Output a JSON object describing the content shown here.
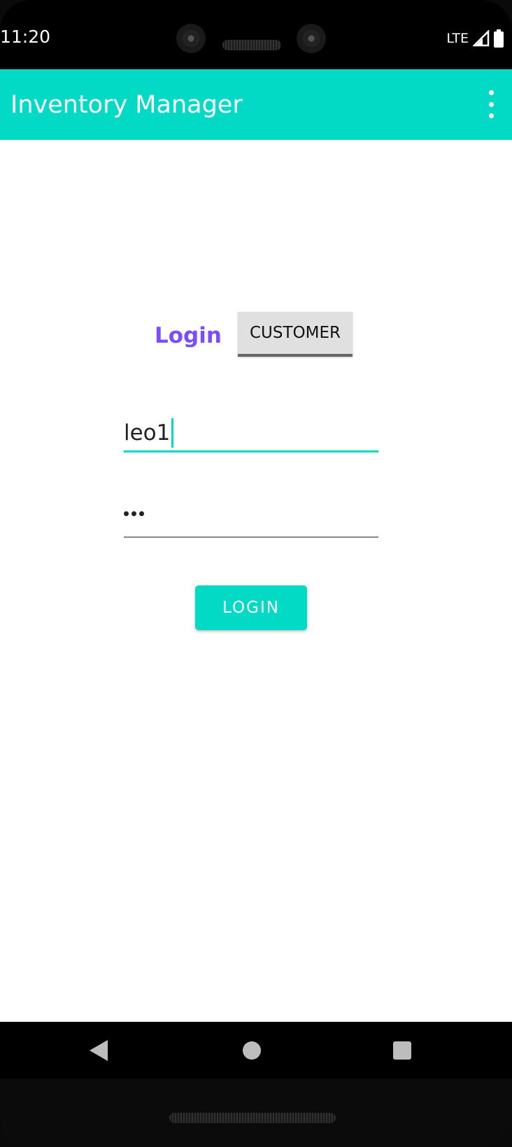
{
  "status_bar": {
    "time": "11:20",
    "network": "LTE",
    "signal_icon": "cell-signal-icon",
    "battery_icon": "battery-icon"
  },
  "app_bar": {
    "title": "Inventory Manager",
    "menu_icon": "overflow-menu-icon",
    "background_color": "#03dac5"
  },
  "login_form": {
    "heading": "Login",
    "heading_color": "#7c4dff",
    "mode_button_label": "CUSTOMER",
    "username_value": "leo1",
    "password_mask": "•••",
    "password_length": 3,
    "submit_label": "LOGIN",
    "accent_color": "#03dac5"
  },
  "nav_bar": {
    "back_icon": "back-triangle-icon",
    "home_icon": "home-circle-icon",
    "recents_icon": "recents-square-icon"
  }
}
